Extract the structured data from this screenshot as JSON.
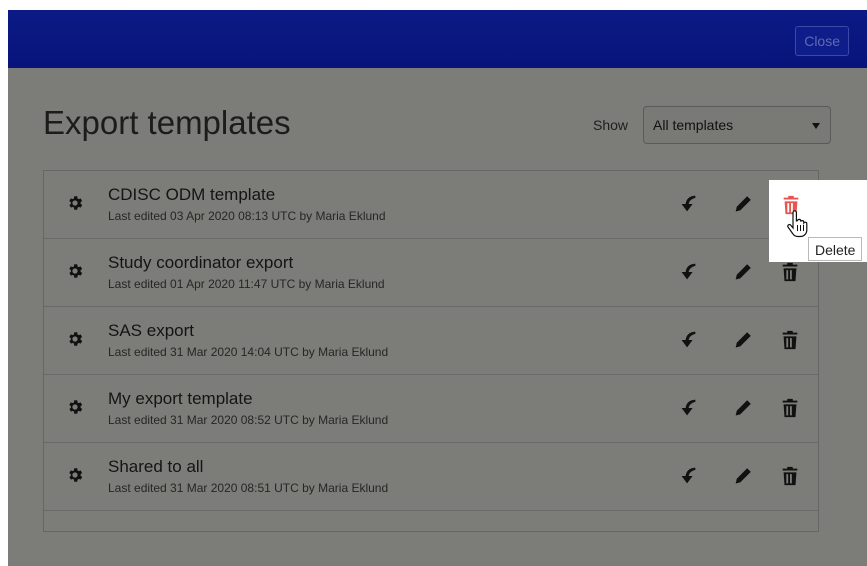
{
  "header": {
    "close_label": "Close"
  },
  "page": {
    "title": "Export templates"
  },
  "filter": {
    "label": "Show",
    "selected": "All templates"
  },
  "templates": [
    {
      "name": "CDISC ODM template",
      "meta": "Last edited 03 Apr 2020 08:13 UTC by Maria Eklund"
    },
    {
      "name": "Study coordinator export",
      "meta": "Last edited 01 Apr 2020 11:47 UTC by Maria Eklund"
    },
    {
      "name": "SAS export",
      "meta": "Last edited 31 Mar 2020 14:04 UTC by Maria Eklund"
    },
    {
      "name": "My export template",
      "meta": "Last edited 31 Mar 2020 08:52 UTC by Maria Eklund"
    },
    {
      "name": "Shared to all",
      "meta": "Last edited 31 Mar 2020 08:51 UTC by Maria Eklund"
    }
  ],
  "tooltip": {
    "text": "Delete"
  },
  "icons": {
    "settings": "gear-icon",
    "restore": "restore-arrow-icon",
    "edit": "pencil-icon",
    "delete": "trash-icon",
    "pointer": "hand-cursor-icon"
  },
  "colors": {
    "header": "#0b1a86",
    "delete_hover": "#e8544f",
    "overlay": "#7c7d78"
  }
}
